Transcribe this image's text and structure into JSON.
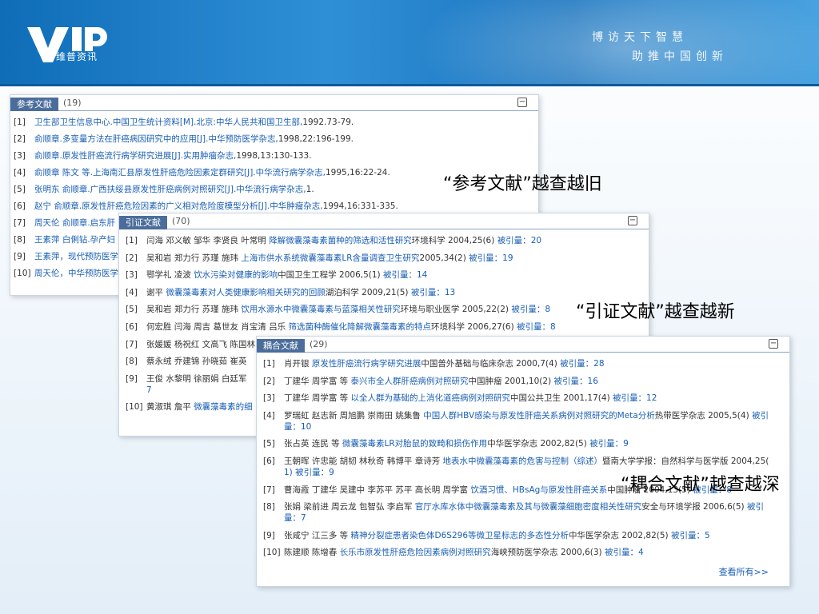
{
  "banner": {
    "logo_sub": "维普资讯",
    "slogan_line1": "博访天下智慧",
    "slogan_line2": "助推中国创新"
  },
  "panel1": {
    "tab": "参考文献",
    "count": "(19)",
    "items": [
      {
        "num": "[1]",
        "link": "卫生部卫生信息中心.中国卫生统计资料[M].北京:中华人民共和国卫生部,",
        "rest": "1992.73-79."
      },
      {
        "num": "[2]",
        "link": "俞顺章.多变量方法在肝癌病因研究中的应用[J].中华预防医学杂志,",
        "rest": "1998,22:196-199."
      },
      {
        "num": "[3]",
        "link": "俞顺章.原发性肝癌流行病学研究进展[J].实用肿瘤杂志,",
        "rest": "1998,13:130-133."
      },
      {
        "num": "[4]",
        "link": "俞顺章 陈文 等.上海南汇县原发性肝癌危险因素定群研究[J].中华流行病学杂志,",
        "rest": "1995,16:22-24."
      },
      {
        "num": "[5]",
        "link": "张明东 俞顺章.广西扶绥县原发性肝癌病例对照研究[J].中华流行病学杂志,",
        "rest": "1."
      },
      {
        "num": "[6]",
        "link": "赵宁 俞顺章.原发性肝癌危险因素的广义相对危险度模型分析[J].中华肿瘤杂志,",
        "rest": "1994,16:331-335."
      },
      {
        "num": "[7]",
        "link": "周天伦 俞顺章.启东肝",
        "rest": ""
      },
      {
        "num": "[8]",
        "link": "王素萍 白俐钻.孕产妇",
        "rest": ""
      },
      {
        "num": "[9]",
        "link": "王素萍，现代预防医学",
        "rest": ""
      },
      {
        "num": "[10]",
        "link": "周天伦，中华预防医学",
        "rest": ""
      }
    ]
  },
  "panel2": {
    "tab": "引证文献",
    "count": "(70)",
    "items": [
      {
        "num": "[1]",
        "authors": "闫海 邓义敏 邹华 李贤良 叶常明",
        "title": "降解微囊藻毒素菌种的筛选和活性研究",
        "source": "环境科学 2004,25(6)",
        "cite": "被引量：",
        "cite_n": "20"
      },
      {
        "num": "[2]",
        "authors": "吴和岩 郑力行 苏瑾 施玮",
        "title": "上海市供水系统微囊藻毒素LR含量调查卫生研究",
        "source": "2005,34(2)",
        "cite": "被引量：",
        "cite_n": "19"
      },
      {
        "num": "[3]",
        "authors": "鄂学礼 凌波",
        "title": "饮水污染对健康的影响",
        "source": "中国卫生工程学 2006,5(1)",
        "cite": "被引量：",
        "cite_n": "14"
      },
      {
        "num": "[4]",
        "authors": "谢平",
        "title": "微囊藻毒素对人类健康影响相关研究的回顾",
        "source": "湖泊科学 2009,21(5)",
        "cite": "被引量：",
        "cite_n": "13"
      },
      {
        "num": "[5]",
        "authors": "吴和岩 郑力行 苏瑾 施玮",
        "title": "饮用水源水中微囊藻毒素与蓝藻相关性研究",
        "source": "环境与职业医学 2005,22(2)",
        "cite": "被引量：",
        "cite_n": "8"
      },
      {
        "num": "[6]",
        "authors": "何宏胜 闫海 周吉 葛世友 肖宝清 吕乐",
        "title": "筛选菌种酶催化降解微囊藻毒素的特点",
        "source": "环境科学 2006,27(6)",
        "cite": "被引量：",
        "cite_n": "8"
      },
      {
        "num": "[7]",
        "authors": "张媛媛 杨祝红 文高飞 陈国林",
        "title": "",
        "source": "",
        "cite": "",
        "cite_n": ""
      },
      {
        "num": "[8]",
        "authors": "蔡永绒 乔建锦 孙晓茹 崔英",
        "title": "",
        "source": "",
        "cite": "",
        "cite_n": ""
      },
      {
        "num": "[9]",
        "authors": "王俊 水黎明 徐丽娟 白廷军",
        "title": "",
        "source": "",
        "cite": "",
        "cite_n": ""
      },
      {
        "num": "[10]",
        "authors": "黄淑琪 詹平",
        "title": "微囊藻毒素的细",
        "source": "",
        "cite": "",
        "cite_n": ""
      }
    ],
    "item9_cont": "7"
  },
  "panel3": {
    "tab": "耦合文献",
    "count": "(29)",
    "view_all": "查看所有>>",
    "items": [
      {
        "num": "[1]",
        "authors": "肖开银",
        "title": "原发性肝癌流行病学研究进展",
        "source": "中国普外基础与临床杂志 2000,7(4)",
        "cite": "被引量：",
        "cite_n": "28",
        "cont": ""
      },
      {
        "num": "[2]",
        "authors": "丁建华 周学富 等",
        "title": "泰兴市全人群肝癌病例对照研究",
        "source": "中国肿瘤 2001,10(2)",
        "cite": "被引量：",
        "cite_n": "16",
        "cont": ""
      },
      {
        "num": "[3]",
        "authors": "丁建华 周学富 等",
        "title": "以全人群为基础的上消化道癌病例对照研究",
        "source": "中国公共卫生 2001,17(4)",
        "cite": "被引量：",
        "cite_n": "12",
        "cont": ""
      },
      {
        "num": "[4]",
        "authors": "罗瑞虹 赵志新 周旭鹏 崇雨田 姚集鲁",
        "title": "中国人群HBV感染与原发性肝癌关系病例对照研究的Meta分析",
        "source": "热带医学杂志 2005,5(4)",
        "cite": "被引",
        "cite_n": "",
        "cont": "量：10"
      },
      {
        "num": "[5]",
        "authors": "张占英 连民 等",
        "title": "微囊藻毒素LR对胎鼠的致畸和损伤作用",
        "source": "中华医学杂志 2002,82(5)",
        "cite": "被引量：",
        "cite_n": "9",
        "cont": ""
      },
      {
        "num": "[6]",
        "authors": "王朝晖 许忠能 胡韧 林秋奇 韩博平 章诗芳",
        "title": "地表水中微囊藻毒素的危害与控制（综述）",
        "source": "暨南大学学报：自然科学与医学版 2004,25(",
        "cite": "",
        "cite_n": "",
        "cont": "1) 被引量：9"
      },
      {
        "num": "[7]",
        "authors": "曹海霞 丁建华 吴建中 李苏平 苏平 高长明 周学富",
        "title": "饮酒习惯、HBsAg与原发性肝癌关系",
        "source": "中国肿瘤 2004,13(5)",
        "cite": "被引量：",
        "cite_n": "8",
        "cont": ""
      },
      {
        "num": "[8]",
        "authors": "张娟 梁前进 周云龙 包智弘 李启军",
        "title": "官厅水库水体中微囊藻毒素及其与微囊藻细胞密度相关性研究",
        "source": "安全与环境学报 2006,6(5)",
        "cite": "被引",
        "cite_n": "",
        "cont": "量：7"
      },
      {
        "num": "[9]",
        "authors": "张咸宁 江三多 等",
        "title": "精神分裂症患者染色体D6S296等微卫星标志的多态性分析",
        "source": "中华医学杂志 2002,82(5)",
        "cite": "被引量：",
        "cite_n": "5",
        "cont": ""
      },
      {
        "num": "[10]",
        "authors": "陈建顺 陈增春",
        "title": "长乐市原发性肝癌危险因素病例对照研究",
        "source": "海峡预防医学杂志 2000,6(3)",
        "cite": "被引量：",
        "cite_n": "4",
        "cont": ""
      }
    ]
  },
  "annotations": {
    "a1": "“参考文献”越查越旧",
    "a2": "“引证文献”越查越新",
    "a3": "“耦合文献”越查越深"
  }
}
